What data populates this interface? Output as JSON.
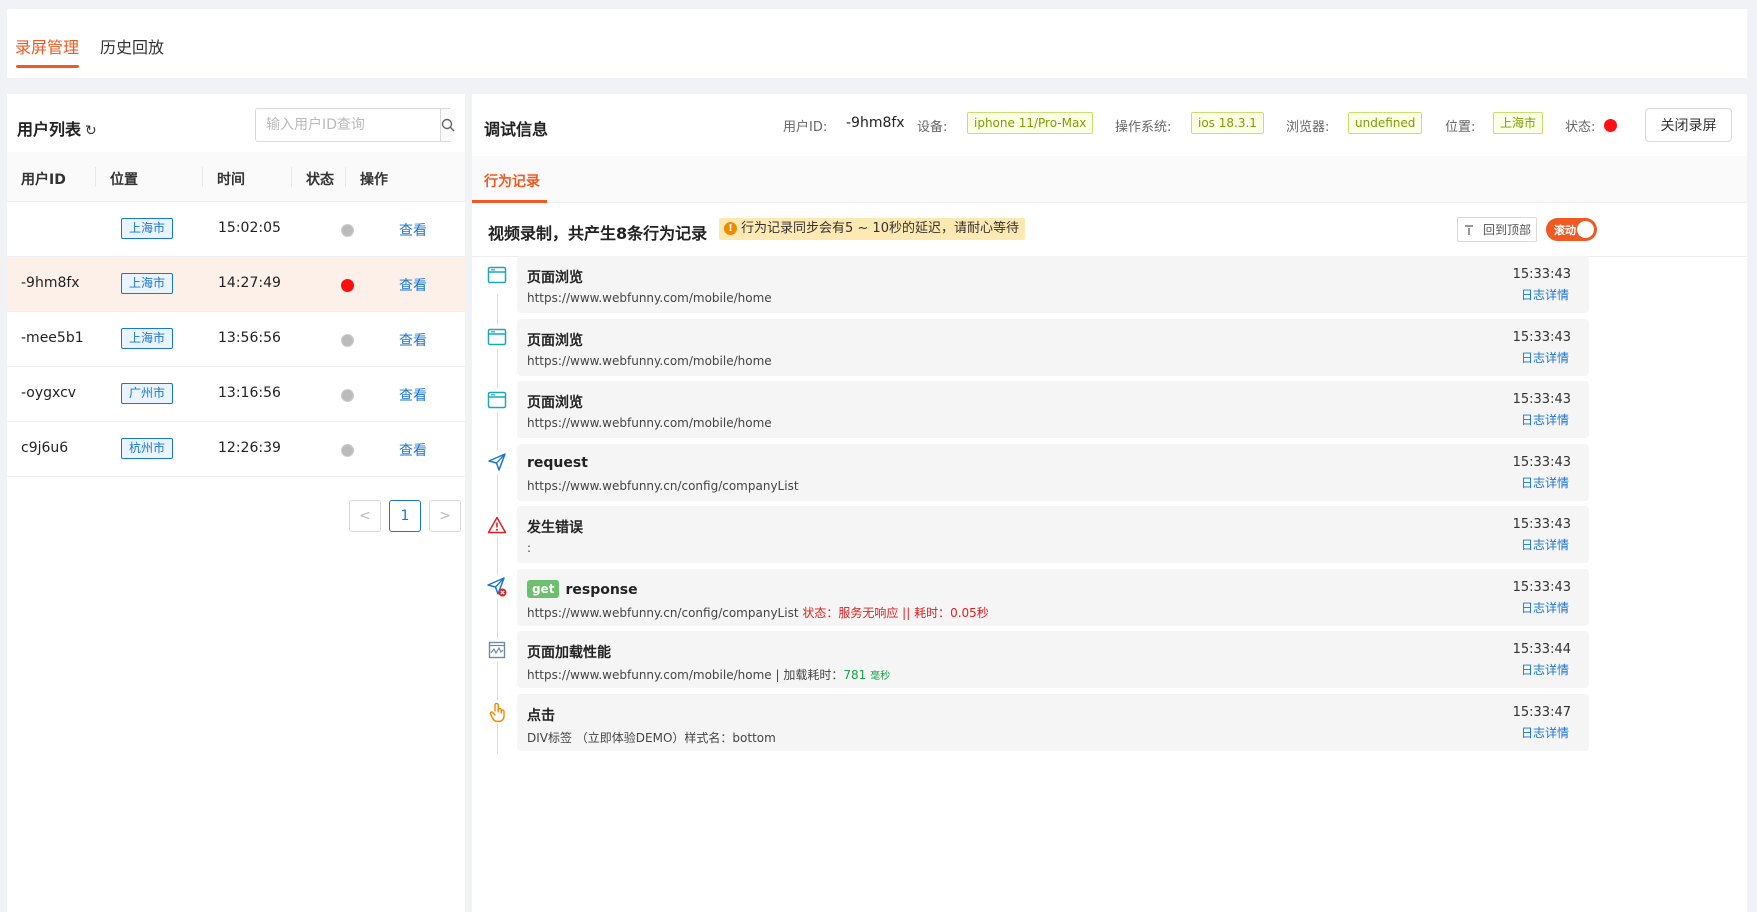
{
  "top_tabs": [
    "录屏管理",
    "历史回放"
  ],
  "left": {
    "title": "用户列表",
    "refresh_icon": "refresh-icon",
    "search_placeholder": "输入用户ID查询",
    "columns": [
      "用户ID",
      "位置",
      "时间",
      "状态",
      "操作"
    ],
    "rows": [
      {
        "id": "",
        "location": "上海市",
        "time": "15:02:05",
        "status": "offline",
        "action": "查看"
      },
      {
        "id": "-9hm8fx",
        "location": "上海市",
        "time": "14:27:49",
        "status": "online",
        "action": "查看"
      },
      {
        "id": "-mee5b1",
        "location": "上海市",
        "time": "13:56:56",
        "status": "offline",
        "action": "查看"
      },
      {
        "id": "-oygxcv",
        "location": "广州市",
        "time": "13:16:56",
        "status": "offline",
        "action": "查看"
      },
      {
        "id": "c9j6u6",
        "location": "杭州市",
        "time": "12:26:39",
        "status": "offline",
        "action": "查看"
      }
    ],
    "pagination": {
      "prev": "<",
      "current": "1",
      "next": ">"
    }
  },
  "right": {
    "title": "调试信息",
    "user_id_label": "用户ID:",
    "user_id": "-9hm8fx",
    "device_label": "设备:",
    "device": "iphone 11/Pro-Max",
    "os_label": "操作系统:",
    "os": "ios 18.3.1",
    "browser_label": "浏览器:",
    "browser": "undefined",
    "location_label": "位置:",
    "location": "上海市",
    "status_label": "状态:",
    "close_button": "关闭录屏",
    "sub_tab": "行为记录",
    "record_title": "视频录制，共产生8条行为记录",
    "notice": "行为记录同步会有5 ~ 10秒的延迟，请耐心等待",
    "back_top": "回到顶部",
    "scroll_toggle": "滚动",
    "records": [
      {
        "icon": "browser-window-icon",
        "title": "页面浏览",
        "sub": "https://www.webfunny.com/mobile/home",
        "time": "15:33:43",
        "link": "日志详情"
      },
      {
        "icon": "browser-window-icon",
        "title": "页面浏览",
        "sub": "https://www.webfunny.com/mobile/home",
        "time": "15:33:43",
        "link": "日志详情"
      },
      {
        "icon": "browser-window-icon",
        "title": "页面浏览",
        "sub": "https://www.webfunny.com/mobile/home",
        "time": "15:33:43",
        "link": "日志详情"
      },
      {
        "icon": "paper-plane-icon",
        "title": "request",
        "sub": "https://www.webfunny.cn/config/companyList",
        "time": "15:33:43",
        "link": "日志详情"
      },
      {
        "icon": "warning-triangle-icon",
        "title": "发生错误",
        "sub": ":",
        "time": "15:33:43",
        "link": "日志详情"
      },
      {
        "icon": "paper-plane-error-icon",
        "badge": "get",
        "title": "response",
        "sub": "https://www.webfunny.cn/config/companyList",
        "sub_red": "状态：服务无响应 || 耗时：0.05秒",
        "time": "15:33:43",
        "link": "日志详情"
      },
      {
        "icon": "performance-chart-icon",
        "title": "页面加载性能",
        "sub": "https://www.webfunny.com/mobile/home | 加载耗时：",
        "sub_green": "781",
        "sub_unit": "毫秒",
        "time": "15:33:44",
        "link": "日志详情"
      },
      {
        "icon": "tap-finger-icon",
        "title": "点击",
        "sub": "DIV标签 （立即体验DEMO）样式名：bottom",
        "time": "15:33:47",
        "link": "日志详情"
      }
    ]
  },
  "colors": {
    "accent": "#f05a22",
    "link": "#1a76d2",
    "online": "#ff1010",
    "offline": "#bbbbbb"
  }
}
